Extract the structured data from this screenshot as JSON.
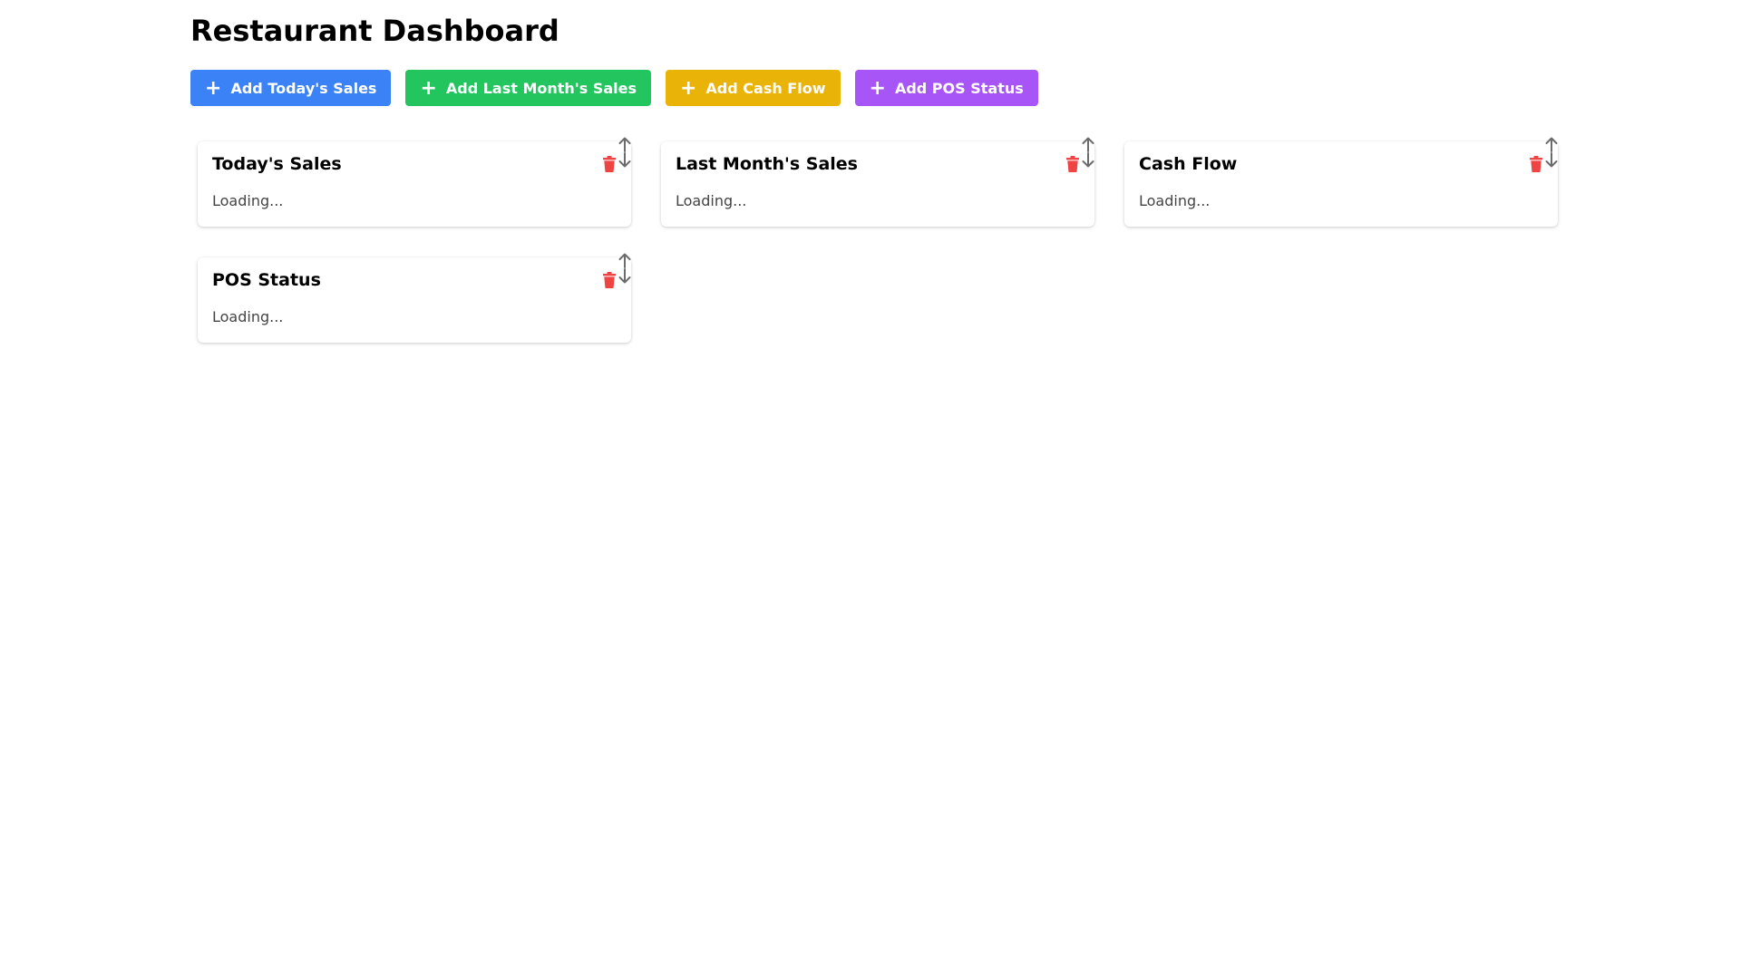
{
  "header": {
    "title": "Restaurant Dashboard"
  },
  "toolbar": {
    "buttons": [
      {
        "label": "Add Today's Sales",
        "color": "#3b82f6"
      },
      {
        "label": "Add Last Month's Sales",
        "color": "#22c55e"
      },
      {
        "label": "Add Cash Flow",
        "color": "#eab308"
      },
      {
        "label": "Add POS Status",
        "color": "#a855f7"
      }
    ],
    "icon": "plus-icon"
  },
  "widgets": [
    {
      "title": "Today's Sales",
      "body": "Loading..."
    },
    {
      "title": "Last Month's Sales",
      "body": "Loading..."
    },
    {
      "title": "Cash Flow",
      "body": "Loading..."
    },
    {
      "title": "POS Status",
      "body": "Loading..."
    }
  ],
  "widget_icons": {
    "delete": "trash-icon",
    "move_up": "arrow-up-icon",
    "move_down": "arrow-down-icon"
  },
  "colors": {
    "delete_icon": "#ef4444",
    "arrow_icon": "#6b6b6b"
  }
}
